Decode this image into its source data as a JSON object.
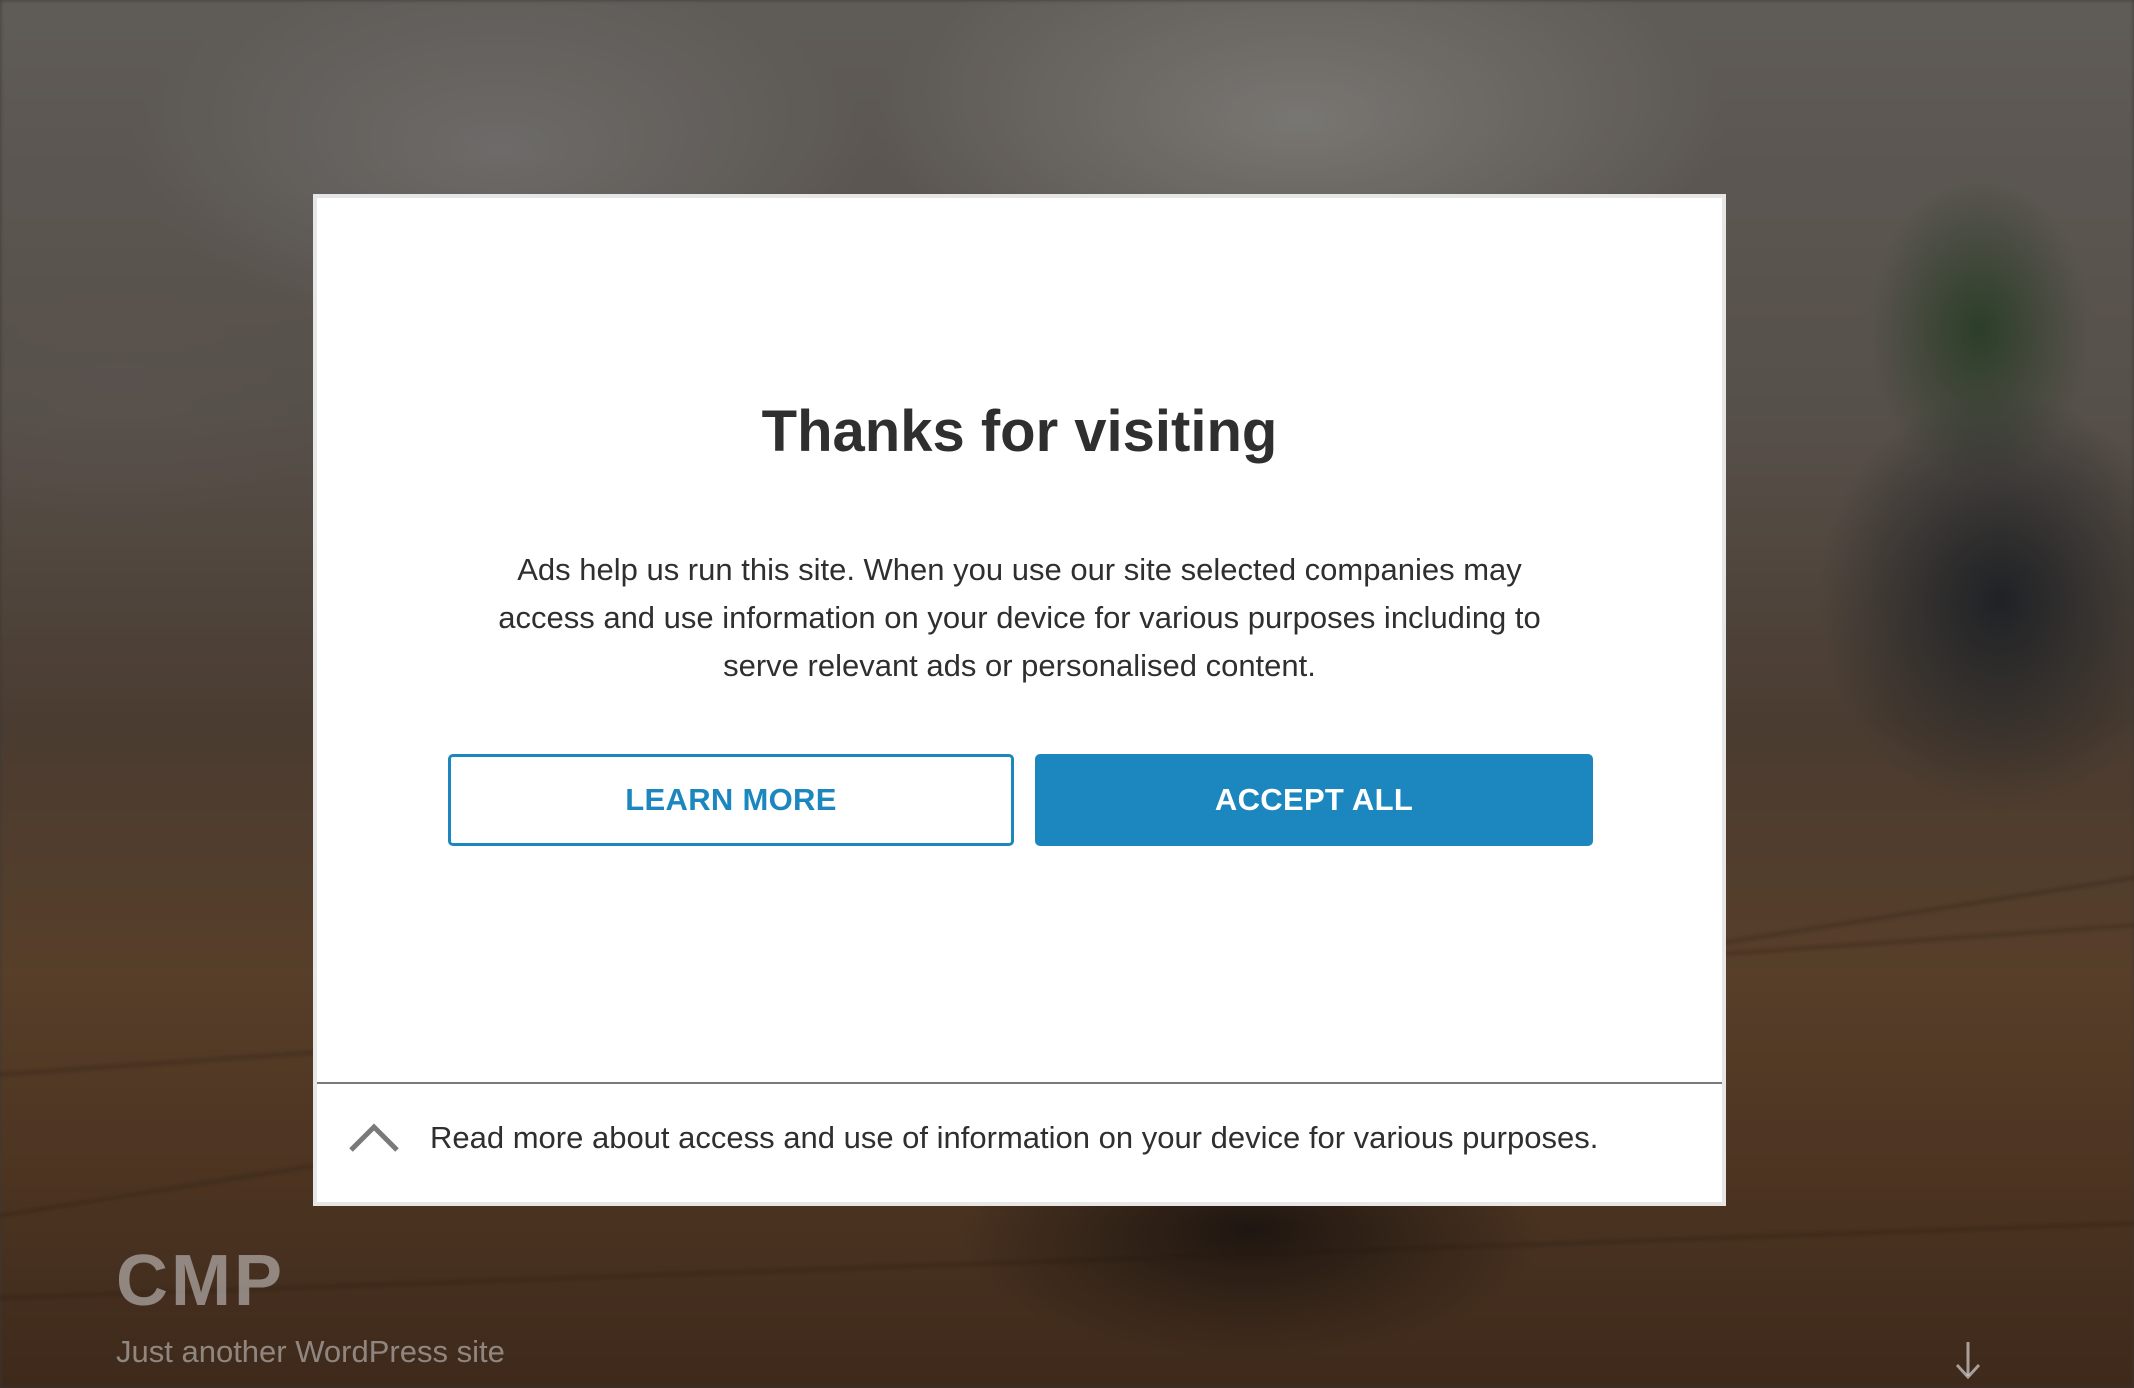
{
  "site": {
    "title": "CMP",
    "tagline": "Just another WordPress site"
  },
  "consent_modal": {
    "title": "Thanks for visiting",
    "body": "Ads help us run this site. When you use our site selected companies may access and use information on your device for various purposes including to serve relevant ads or personalised content.",
    "learn_more_label": "LEARN MORE",
    "accept_all_label": "ACCEPT ALL",
    "read_more_text": "Read more about access and use of information on your device for various purposes."
  },
  "icons": {
    "expand": "chevron-up-icon",
    "scroll": "arrow-down-icon"
  },
  "colors": {
    "accent": "#1c87bf",
    "text": "#2f2f2f",
    "modal_background": "#ffffff"
  }
}
